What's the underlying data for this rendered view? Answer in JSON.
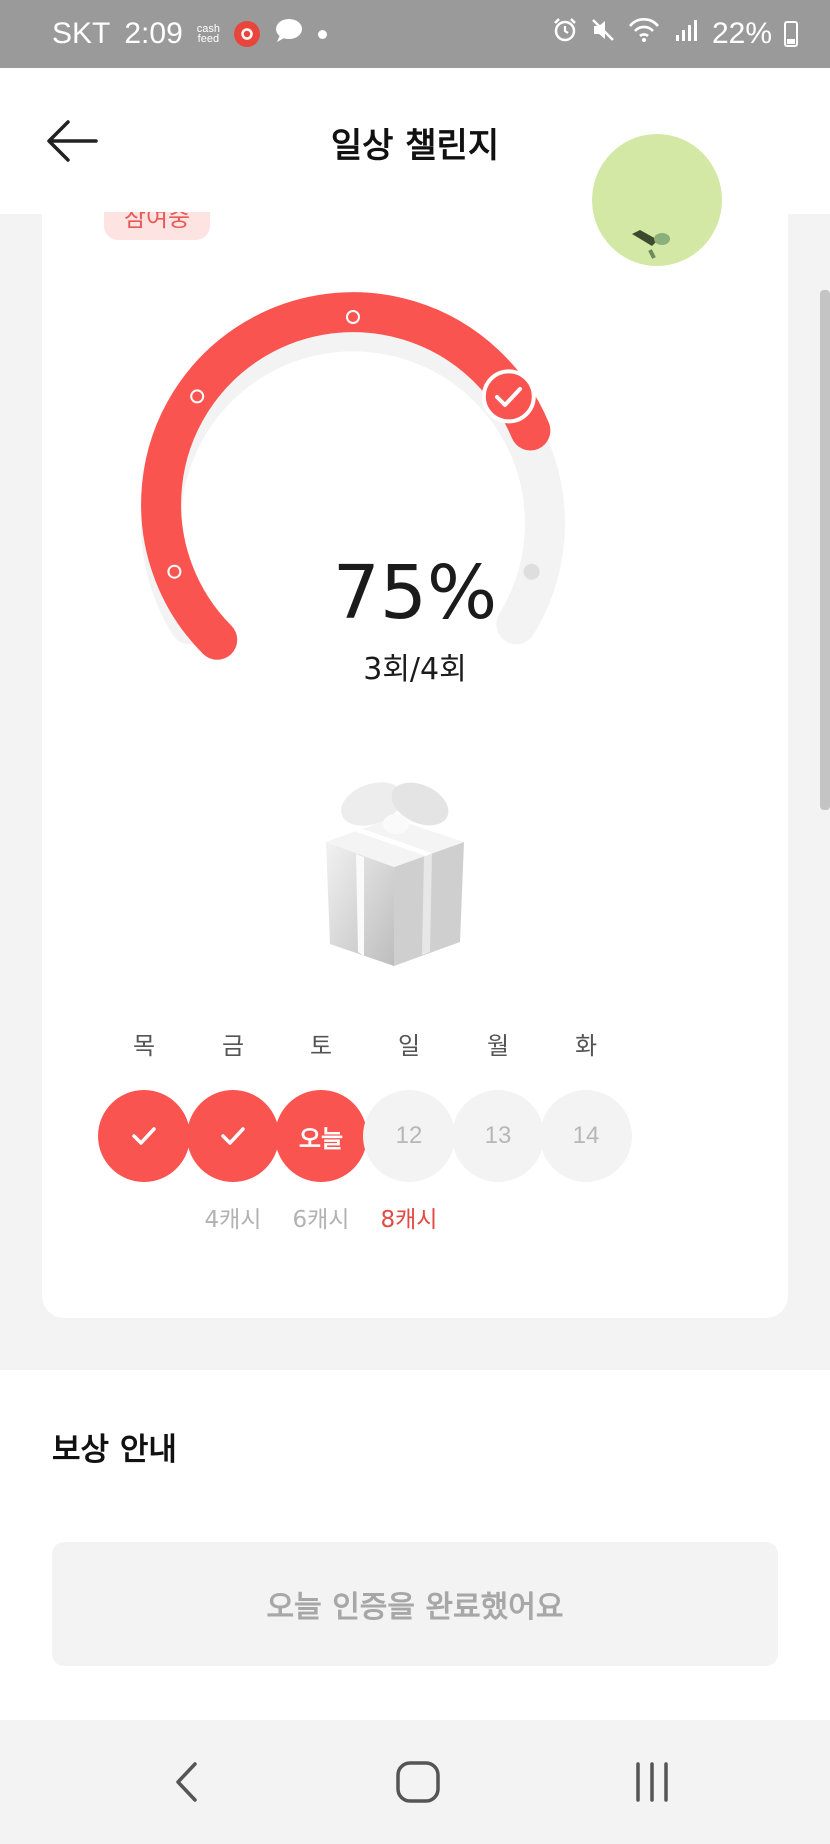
{
  "status_bar": {
    "carrier": "SKT",
    "time": "2:09",
    "cashfeed_icon_text": "cash feed",
    "battery": "22%"
  },
  "header": {
    "title": "일상 챌린지",
    "back_icon": "arrow-left-icon"
  },
  "challenge": {
    "badge_text": "참여중",
    "progress_percent": 75,
    "percent_label": "75%",
    "count_label": "3회/4회",
    "colors": {
      "accent": "#f95450",
      "track": "#f3f3f3"
    }
  },
  "days": [
    {
      "label": "목",
      "value": "",
      "state": "done",
      "reward": ""
    },
    {
      "label": "금",
      "value": "",
      "state": "done",
      "reward": "4캐시"
    },
    {
      "label": "토",
      "value": "오늘",
      "state": "today",
      "reward": "6캐시"
    },
    {
      "label": "일",
      "value": "12",
      "state": "future",
      "reward": "8캐시"
    },
    {
      "label": "월",
      "value": "13",
      "state": "future",
      "reward": ""
    },
    {
      "label": "화",
      "value": "14",
      "state": "future",
      "reward": ""
    }
  ],
  "reward_section": {
    "title": "보상 안내",
    "button_label": "오늘 인증을 완료했어요"
  }
}
